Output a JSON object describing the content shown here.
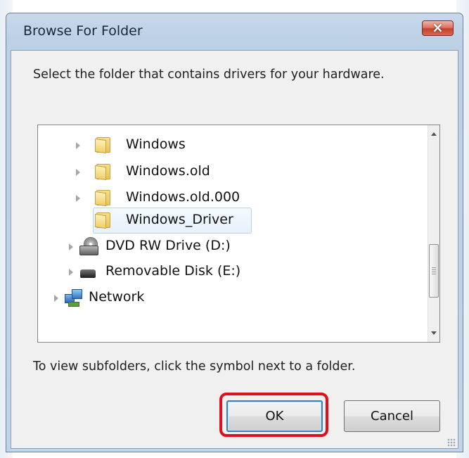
{
  "window": {
    "title": "Browse For Folder",
    "close_label": "×"
  },
  "dialog": {
    "description": "Select the folder that contains drivers for your hardware.",
    "hint": "To view subfolders, click the symbol next to a folder."
  },
  "tree": {
    "items": [
      {
        "label": "Windows",
        "icon": "folder-icon",
        "expandable": true,
        "selected": false
      },
      {
        "label": "Windows.old",
        "icon": "folder-icon",
        "expandable": true,
        "selected": false
      },
      {
        "label": "Windows.old.000",
        "icon": "folder-icon",
        "expandable": true,
        "selected": false
      },
      {
        "label": "Windows_Driver",
        "icon": "folder-icon",
        "expandable": false,
        "selected": true
      },
      {
        "label": "DVD RW Drive (D:)",
        "icon": "dvd-drive-icon",
        "expandable": true,
        "selected": false
      },
      {
        "label": "Removable Disk (E:)",
        "icon": "removable-disk-icon",
        "expandable": true,
        "selected": false
      },
      {
        "label": "Network",
        "icon": "network-icon",
        "expandable": true,
        "selected": false
      }
    ]
  },
  "buttons": {
    "ok": "OK",
    "cancel": "Cancel"
  },
  "colors": {
    "selection_border": "#b5d4f1",
    "highlight": "#e0101a",
    "close_button": "#c4402a"
  }
}
